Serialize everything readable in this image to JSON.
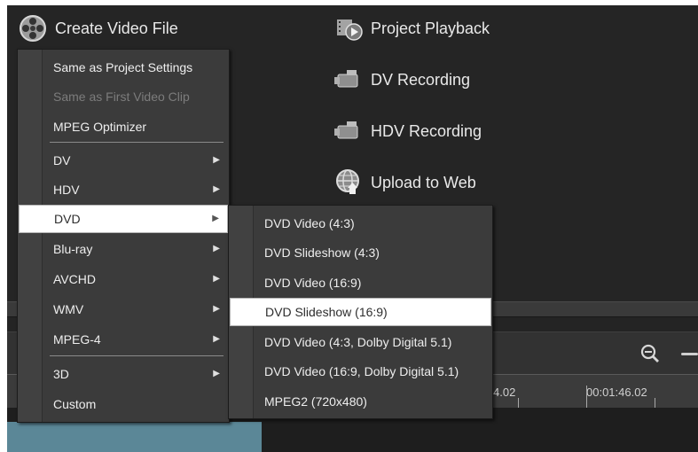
{
  "header": {
    "create_video_file": "Create Video File",
    "project_playback": "Project Playback",
    "dv_recording": "DV Recording",
    "hdv_recording": "HDV Recording",
    "upload_to_web": "Upload to Web"
  },
  "icons": {
    "create_video_file": "film-reel-icon",
    "project_playback": "film-play-icon",
    "dv_recording": "camcorder-icon",
    "hdv_recording": "camcorder-icon",
    "upload_to_web": "globe-upload-icon",
    "zoom_out": "zoom-out-icon",
    "submenu_arrow": "▶"
  },
  "main_menu": {
    "items": [
      {
        "label": "Same as Project Settings"
      },
      {
        "label": "Same as First Video Clip",
        "disabled": true
      },
      {
        "label": "MPEG Optimizer"
      },
      {
        "label": "DV",
        "has_submenu": true
      },
      {
        "label": "HDV",
        "has_submenu": true
      },
      {
        "label": "DVD",
        "has_submenu": true,
        "highlighted": true
      },
      {
        "label": "Blu-ray",
        "has_submenu": true
      },
      {
        "label": "AVCHD",
        "has_submenu": true
      },
      {
        "label": "WMV",
        "has_submenu": true
      },
      {
        "label": "MPEG-4",
        "has_submenu": true
      },
      {
        "label": "3D",
        "has_submenu": true
      },
      {
        "label": "Custom"
      }
    ]
  },
  "dvd_submenu": {
    "items": [
      {
        "label": "DVD Video (4:3)"
      },
      {
        "label": "DVD Slideshow (4:3)"
      },
      {
        "label": "DVD Video (16:9)"
      },
      {
        "label": "DVD Slideshow (16:9)",
        "highlighted": true
      },
      {
        "label": "DVD Video (4:3, Dolby Digital 5.1)"
      },
      {
        "label": "DVD Video (16:9, Dolby Digital 5.1)"
      },
      {
        "label": "MPEG2 (720x480)"
      }
    ]
  },
  "timeline": {
    "partial_time": "4.02",
    "time": "00:01:46.02"
  },
  "colors": {
    "background": "#242424",
    "menu_background": "#3b3b3b",
    "highlight": "#ffffff",
    "track_clip": "#5b8797"
  }
}
